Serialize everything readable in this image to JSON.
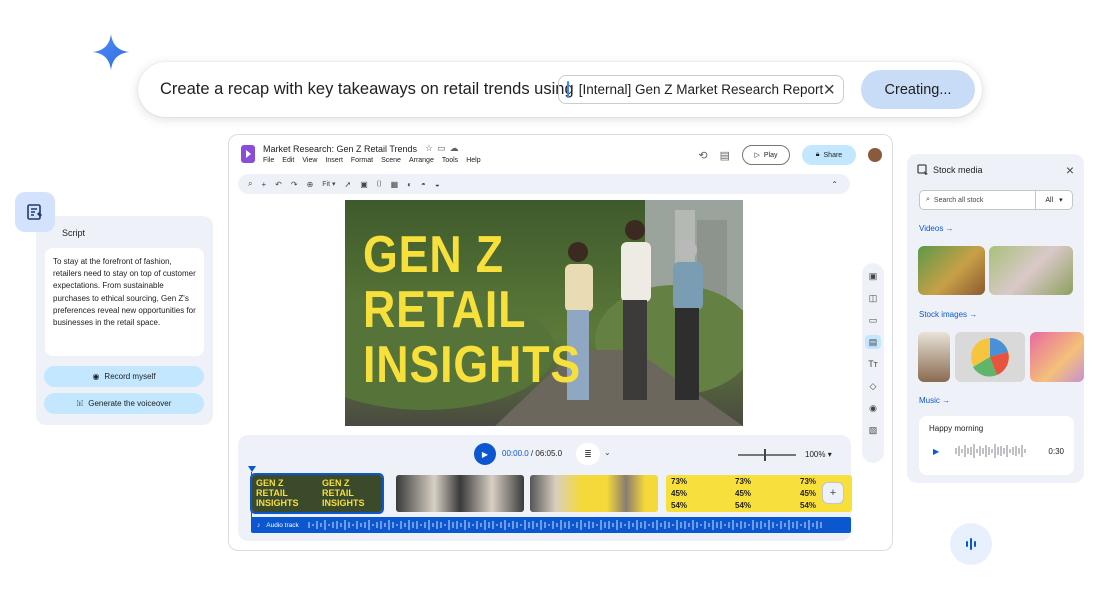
{
  "colors": {
    "accent": "#0b57d0",
    "chip_blue": "#c2e7ff",
    "headline_yellow": "#f7df3c"
  },
  "prompt": {
    "text": "Create a recap with key takeaways on retail trends using",
    "attachment": "[Internal] Gen Z Market Research Report",
    "attachment_icon": "docs-icon",
    "status_button": "Creating..."
  },
  "script_panel": {
    "title": "Script",
    "body": "To stay at the forefront of fashion, retailers need to stay on top of customer expectations. From sustainable purchases to ethical sourcing, Gen Z's preferences reveal new opportunities for businesses in the retail space.",
    "record_button": "Record myself",
    "voiceover_button": "Generate the voiceover"
  },
  "editor": {
    "doc_title": "Market Research: Gen Z Retail Trends",
    "menu": [
      "File",
      "Edit",
      "View",
      "Insert",
      "Format",
      "Scene",
      "Arrange",
      "Tools",
      "Help"
    ],
    "play_button": "Play",
    "share_button": "Share",
    "zoom_fit": "Fit",
    "canvas_headline": [
      "GEN Z",
      "RETAIL",
      "INSIGHTS"
    ],
    "timeline": {
      "current_time": "00:00.0",
      "total_time": "06:05.0",
      "zoom": "100%",
      "audio_label": "Audio track",
      "clip_headline": [
        "GEN Z",
        "RETAIL",
        "INSIGHTS"
      ],
      "clip_percentages": [
        "73%",
        "45%",
        "54%"
      ]
    }
  },
  "stock_media": {
    "title": "Stock media",
    "search_placeholder": "Search all stock",
    "filter": "All",
    "sections": {
      "videos": "Videos",
      "images": "Stock images",
      "music": "Music"
    },
    "music_track": {
      "title": "Happy morning",
      "duration": "0:30"
    }
  }
}
